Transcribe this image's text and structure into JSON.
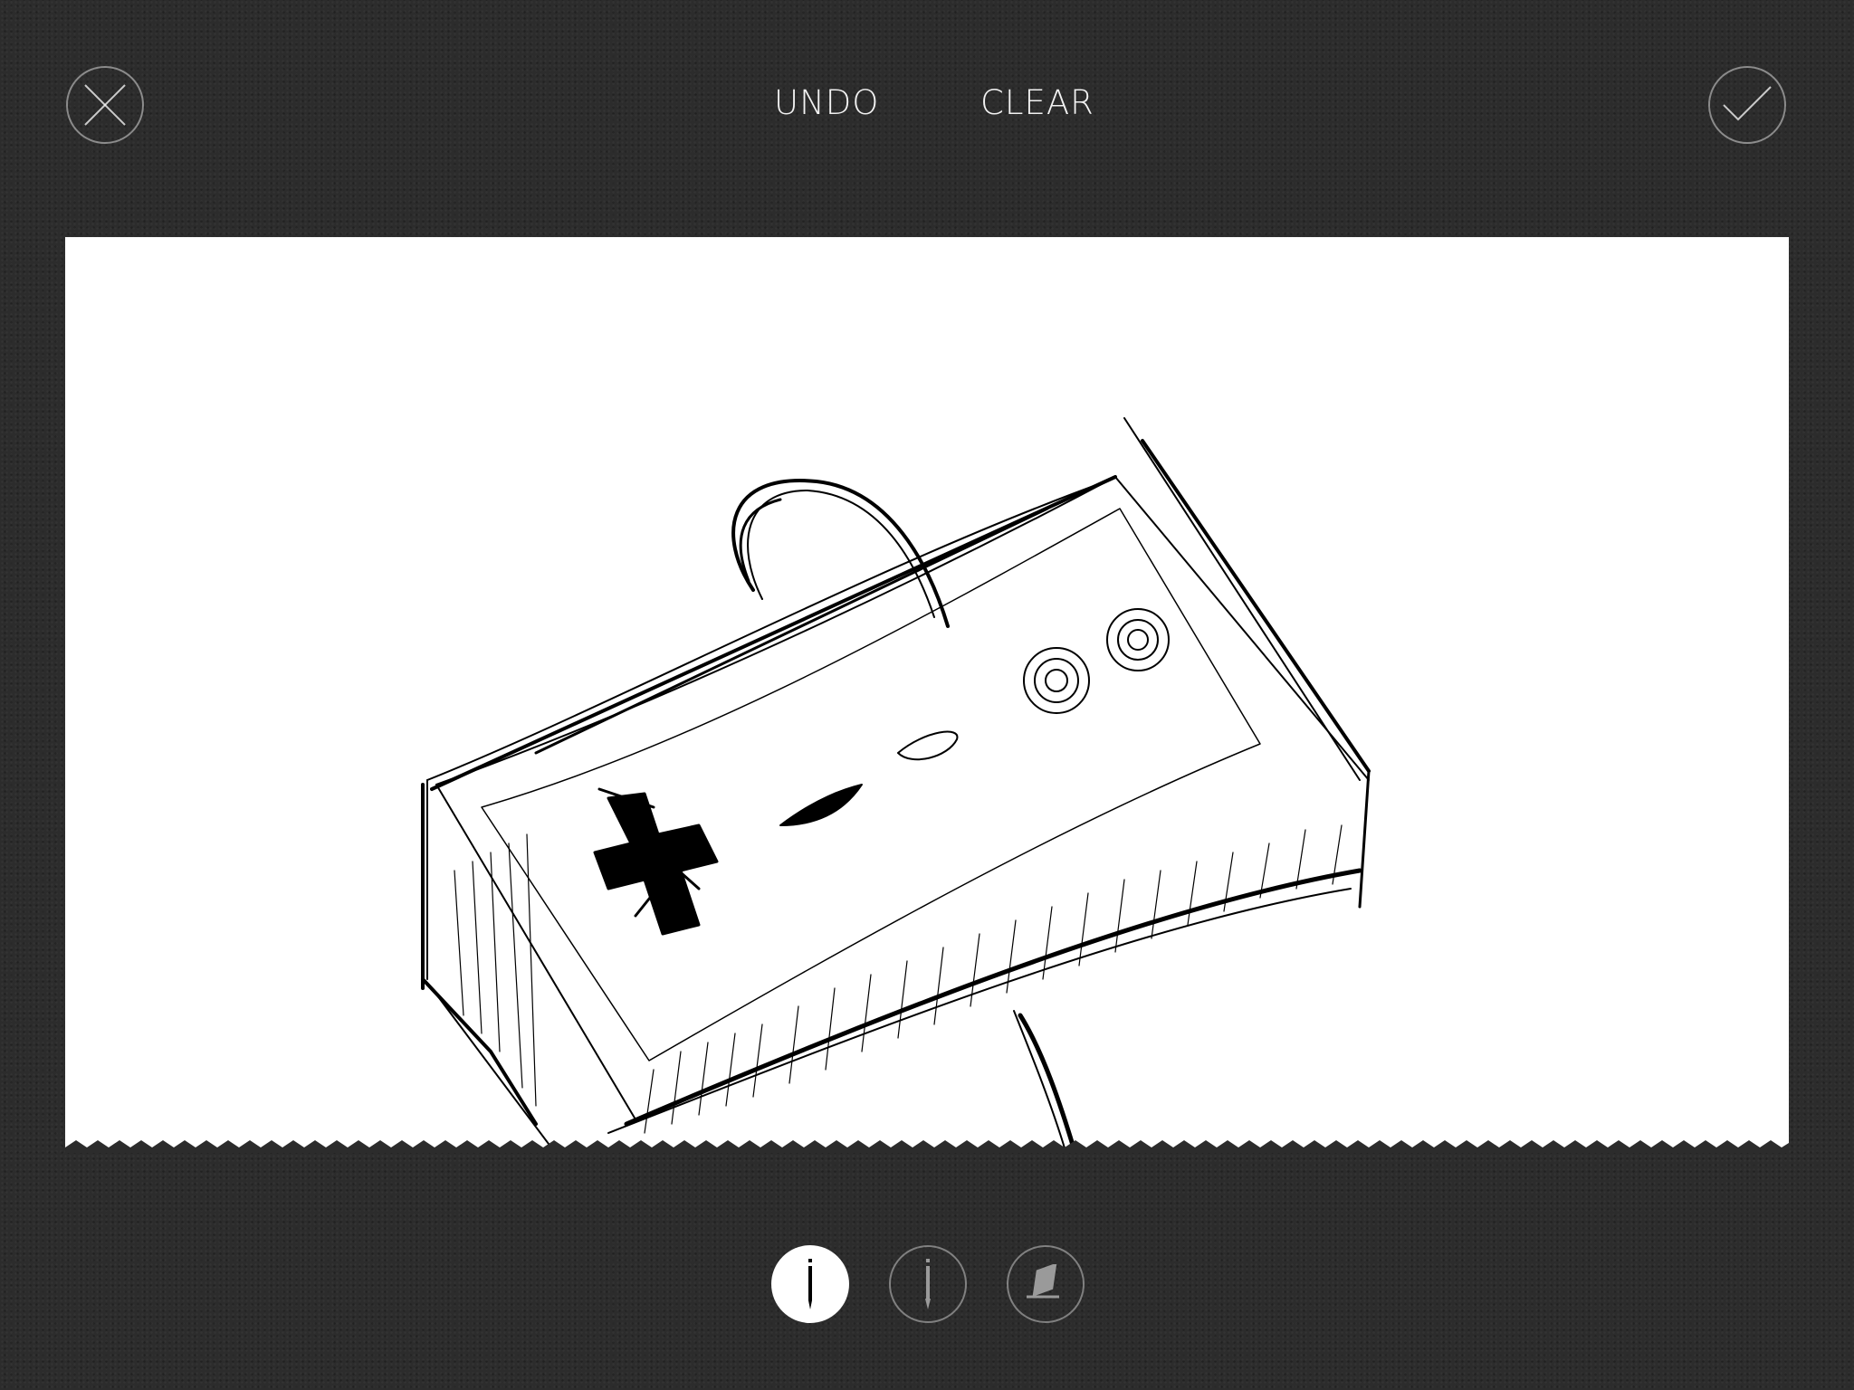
{
  "toolbar": {
    "close_icon": "close-x-icon",
    "undo_label": "UNDO",
    "clear_label": "CLEAR",
    "done_icon": "checkmark-icon"
  },
  "tools": [
    {
      "name": "pen",
      "icon": "pen-icon",
      "selected": true
    },
    {
      "name": "pencil",
      "icon": "pencil-icon",
      "selected": false
    },
    {
      "name": "eraser",
      "icon": "eraser-icon",
      "selected": false
    }
  ],
  "colors": {
    "background": "#2c2c2c",
    "paper": "#ffffff",
    "ink": "#000000",
    "controls": "#f2f2f2"
  }
}
